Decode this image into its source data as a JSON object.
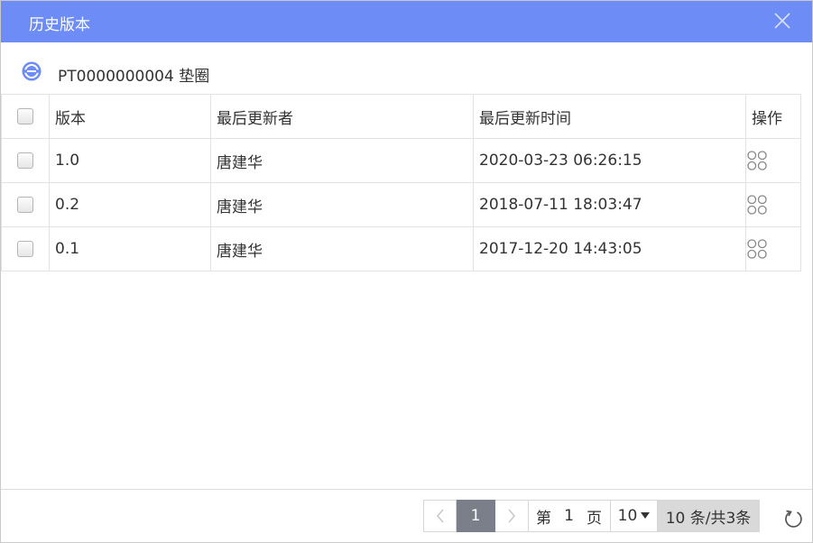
{
  "dialog": {
    "title": "历史版本"
  },
  "item": {
    "title": "PT0000000004 垫圈"
  },
  "table": {
    "headers": {
      "version": "版本",
      "updater": "最后更新者",
      "updated_at": "最后更新时间",
      "actions": "操作"
    },
    "rows": [
      {
        "version": "1.0",
        "updater": "唐建华",
        "updated_at": "2020-03-23 06:26:15"
      },
      {
        "version": "0.2",
        "updater": "唐建华",
        "updated_at": "2018-07-11 18:03:47"
      },
      {
        "version": "0.1",
        "updater": "唐建华",
        "updated_at": "2017-12-20 14:43:05"
      }
    ]
  },
  "pager": {
    "current_page": "1",
    "page_prefix": "第",
    "page_input": "1",
    "page_suffix": "页",
    "page_size": "10",
    "summary": "10 条/共3条"
  },
  "colors": {
    "header": "#6d8cf5",
    "current_page": "#7a7f8a"
  },
  "icons": [
    "close-icon",
    "item-type-icon",
    "operations-grid-icon",
    "chevron-left-icon",
    "chevron-right-icon",
    "dropdown-arrow-icon",
    "refresh-icon"
  ]
}
